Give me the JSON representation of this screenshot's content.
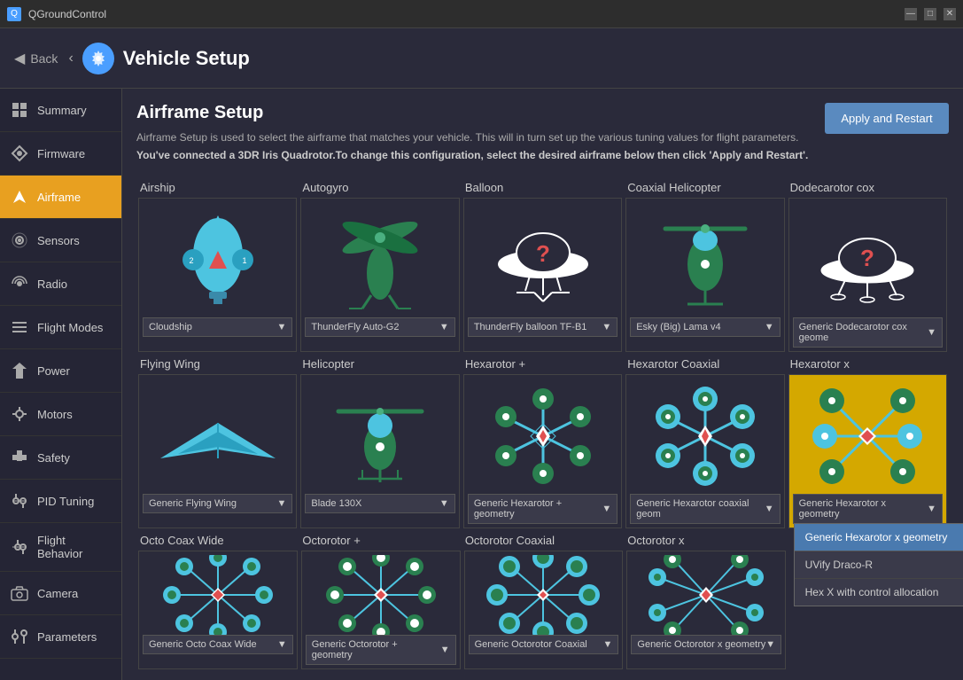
{
  "titlebar": {
    "icon": "Q",
    "title": "QGroundControl",
    "minimize": "—",
    "maximize": "□",
    "close": "✕"
  },
  "header": {
    "back_label": "Back",
    "title": "Vehicle Setup"
  },
  "sidebar": {
    "items": [
      {
        "id": "summary",
        "label": "Summary",
        "icon": "◑"
      },
      {
        "id": "firmware",
        "label": "Firmware",
        "icon": "⬆"
      },
      {
        "id": "airframe",
        "label": "Airframe",
        "icon": "✈"
      },
      {
        "id": "sensors",
        "label": "Sensors",
        "icon": "◎"
      },
      {
        "id": "radio",
        "label": "Radio",
        "icon": "⊙"
      },
      {
        "id": "flight_modes",
        "label": "Flight Modes",
        "icon": "≋"
      },
      {
        "id": "power",
        "label": "Power",
        "icon": "⬡"
      },
      {
        "id": "motors",
        "label": "Motors",
        "icon": "⊕"
      },
      {
        "id": "safety",
        "label": "Safety",
        "icon": "+"
      },
      {
        "id": "pid_tuning",
        "label": "PID Tuning",
        "icon": "⊿"
      },
      {
        "id": "flight_behavior",
        "label": "Flight Behavior",
        "icon": "⊿"
      },
      {
        "id": "camera",
        "label": "Camera",
        "icon": "⬡"
      },
      {
        "id": "parameters",
        "label": "Parameters",
        "icon": "⊿"
      }
    ]
  },
  "main": {
    "title": "Airframe Setup",
    "desc": "Airframe Setup is used to select the airframe that matches your vehicle. This will in turn set up the various tuning values for flight parameters.",
    "desc_bold": "You've connected a 3DR Iris Quadrotor.To change this configuration, select the desired airframe below then click 'Apply and Restart'.",
    "apply_btn": "Apply and Restart"
  },
  "categories_row1": [
    "Airship",
    "Autogyro",
    "Balloon",
    "Coaxial Helicopter",
    "Dodecarotor cox"
  ],
  "categories_row2": [
    "Flying Wing",
    "Helicopter",
    "Hexarotor +",
    "Hexarotor Coaxial",
    "Hexarotor x"
  ],
  "categories_row3": [
    "Octo Coax Wide",
    "Octorotor +",
    "Octorotor Coaxial",
    "Octorotor x",
    ""
  ],
  "dropdowns": {
    "row1": [
      "Cloudship",
      "ThunderFly Auto-G2",
      "ThunderFly balloon TF-B1",
      "Esky (Big) Lama v4",
      "Generic Dodecarotor cox geome"
    ],
    "row2": [
      "Generic Flying Wing",
      "Blade 130X",
      "Generic Hexarotor + geometry",
      "Generic Hexarotor coaxial geom",
      "Generic Hexarotor x geometry"
    ],
    "row3": [
      "Generic Octo Coax Wide",
      "Generic Octorotor + geometry",
      "Generic Octorotor Coaxial",
      "Generic Octorotor x geometry",
      ""
    ]
  },
  "hexarotor_x_dropdown": {
    "options": [
      {
        "label": "Generic Hexarotor x geometry",
        "selected": true
      },
      {
        "label": "UVify Draco-R",
        "selected": false
      },
      {
        "label": "Hex X with control allocation",
        "selected": false
      }
    ]
  }
}
